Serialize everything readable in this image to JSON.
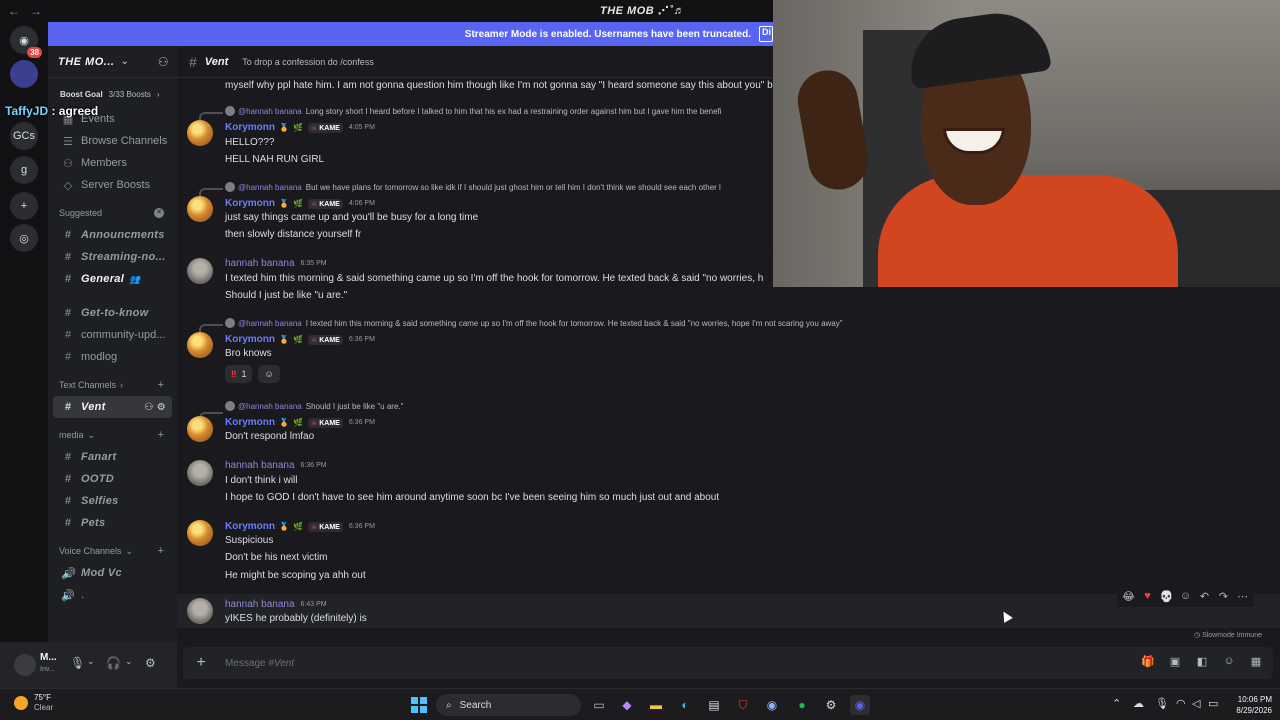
{
  "app": {
    "title": "THE MOB ⋰˚♬"
  },
  "rail": {
    "badge": "38",
    "gcs_label": "GCs"
  },
  "streamer_notice": "Streamer Mode is enabled. Usernames have been truncated.",
  "server": {
    "name": "THE MO...",
    "boost_goal_label": "Boost Goal",
    "boost_count": "3/33 Boosts"
  },
  "sidebar": {
    "top_items": [
      "Events",
      "Browse Channels",
      "Members",
      "Server Boosts"
    ],
    "suggested_label": "Suggested",
    "suggested": [
      "Announcments",
      "Streaming-no...",
      "General"
    ],
    "misc_channels": [
      "Get-to-know",
      "community-upd...",
      "modlog"
    ],
    "text_channels_label": "Text Channels",
    "text_channels": [
      "Vent"
    ],
    "media_label": "media",
    "media_channels": [
      "Fanart",
      "OOTD",
      "Selfies",
      "Pets"
    ],
    "voice_label": "Voice Channels",
    "voice_channels": [
      "Mod Vc",
      "."
    ]
  },
  "user_panel": {
    "name": "M...",
    "status": "Inv..."
  },
  "channel": {
    "name": "Vent",
    "topic": "To drop a confession do /confess"
  },
  "messages": {
    "m0_line": "myself why ppl hate him. I am not gonna question him though like I'm not gonna say \"I heard someone say this about you\" b",
    "m1_reply_name": "@hannah banana",
    "m1_reply_text": "Long story short I heard before I talked to him that his ex had a restraining order against him but I gave him the benefi",
    "m1_author": "Korymonn",
    "m1_tag": "KAME",
    "m1_time": "4:05 PM",
    "m1_lines": [
      "HELLO???",
      "HELL NAH RUN GIRL"
    ],
    "m2_reply_name": "@hannah banana",
    "m2_reply_text": "But we have plans for tomorrow so like idk if I should just ghost him or tell him I don't think we should see each other l",
    "m2_author": "Korymonn",
    "m2_tag": "KAME",
    "m2_time": "4:06 PM",
    "m2_lines": [
      "just say things came up and you'll be busy for a long time",
      "then slowly distance yourself fr"
    ],
    "m3_author": "hannah banana",
    "m3_time": "6:35 PM",
    "m3_lines": [
      "I texted him this morning & said something came up so I'm off the hook for tomorrow. He texted back & said \"no worries, h",
      "Should I just be like \"u are.\""
    ],
    "m4_reply_name": "@hannah banana",
    "m4_reply_text": "I texted him this morning & said something came up so I'm off the hook for tomorrow. He texted back & said \"no worries, hope I'm not scaring you away\"",
    "m4_author": "Korymonn",
    "m4_tag": "KAME",
    "m4_time": "6:36 PM",
    "m4_lines": [
      "Bro knows"
    ],
    "m4_reaction_emoji": "‼",
    "m4_reaction_count": "1",
    "m5_reply_name": "@hannah banana",
    "m5_reply_text": "Should I just be like \"u are.\"",
    "m5_author": "Korymonn",
    "m5_tag": "KAME",
    "m5_time": "6:36 PM",
    "m5_lines": [
      "Don't respond lmfao"
    ],
    "m6_author": "hannah banana",
    "m6_time": "6:36 PM",
    "m6_lines": [
      "I don't think i will",
      "I hope to GOD I don't have to see him around anytime soon bc I've been seeing him so much just out and about"
    ],
    "m7_author": "Korymonn",
    "m7_tag": "KAME",
    "m7_time": "6:36 PM",
    "m7_lines": [
      "Suspicious",
      "Don't be his next victim",
      "He might be scoping ya ahh out"
    ],
    "m8_author": "hannah banana",
    "m8_time": "6:43 PM",
    "m8_lines": [
      "yIKES he probably (definitely) is"
    ]
  },
  "slowmode": "Slowmode Immune",
  "composer": {
    "prefix": "Message #",
    "channel": "Vent"
  },
  "overlay": {
    "user": "TaffyJD",
    "text": ": agreed"
  },
  "taskbar": {
    "temp": "75°F",
    "condition": "Clear",
    "search": "Search",
    "time": "10:06 PM",
    "date": "8/29/2026"
  }
}
